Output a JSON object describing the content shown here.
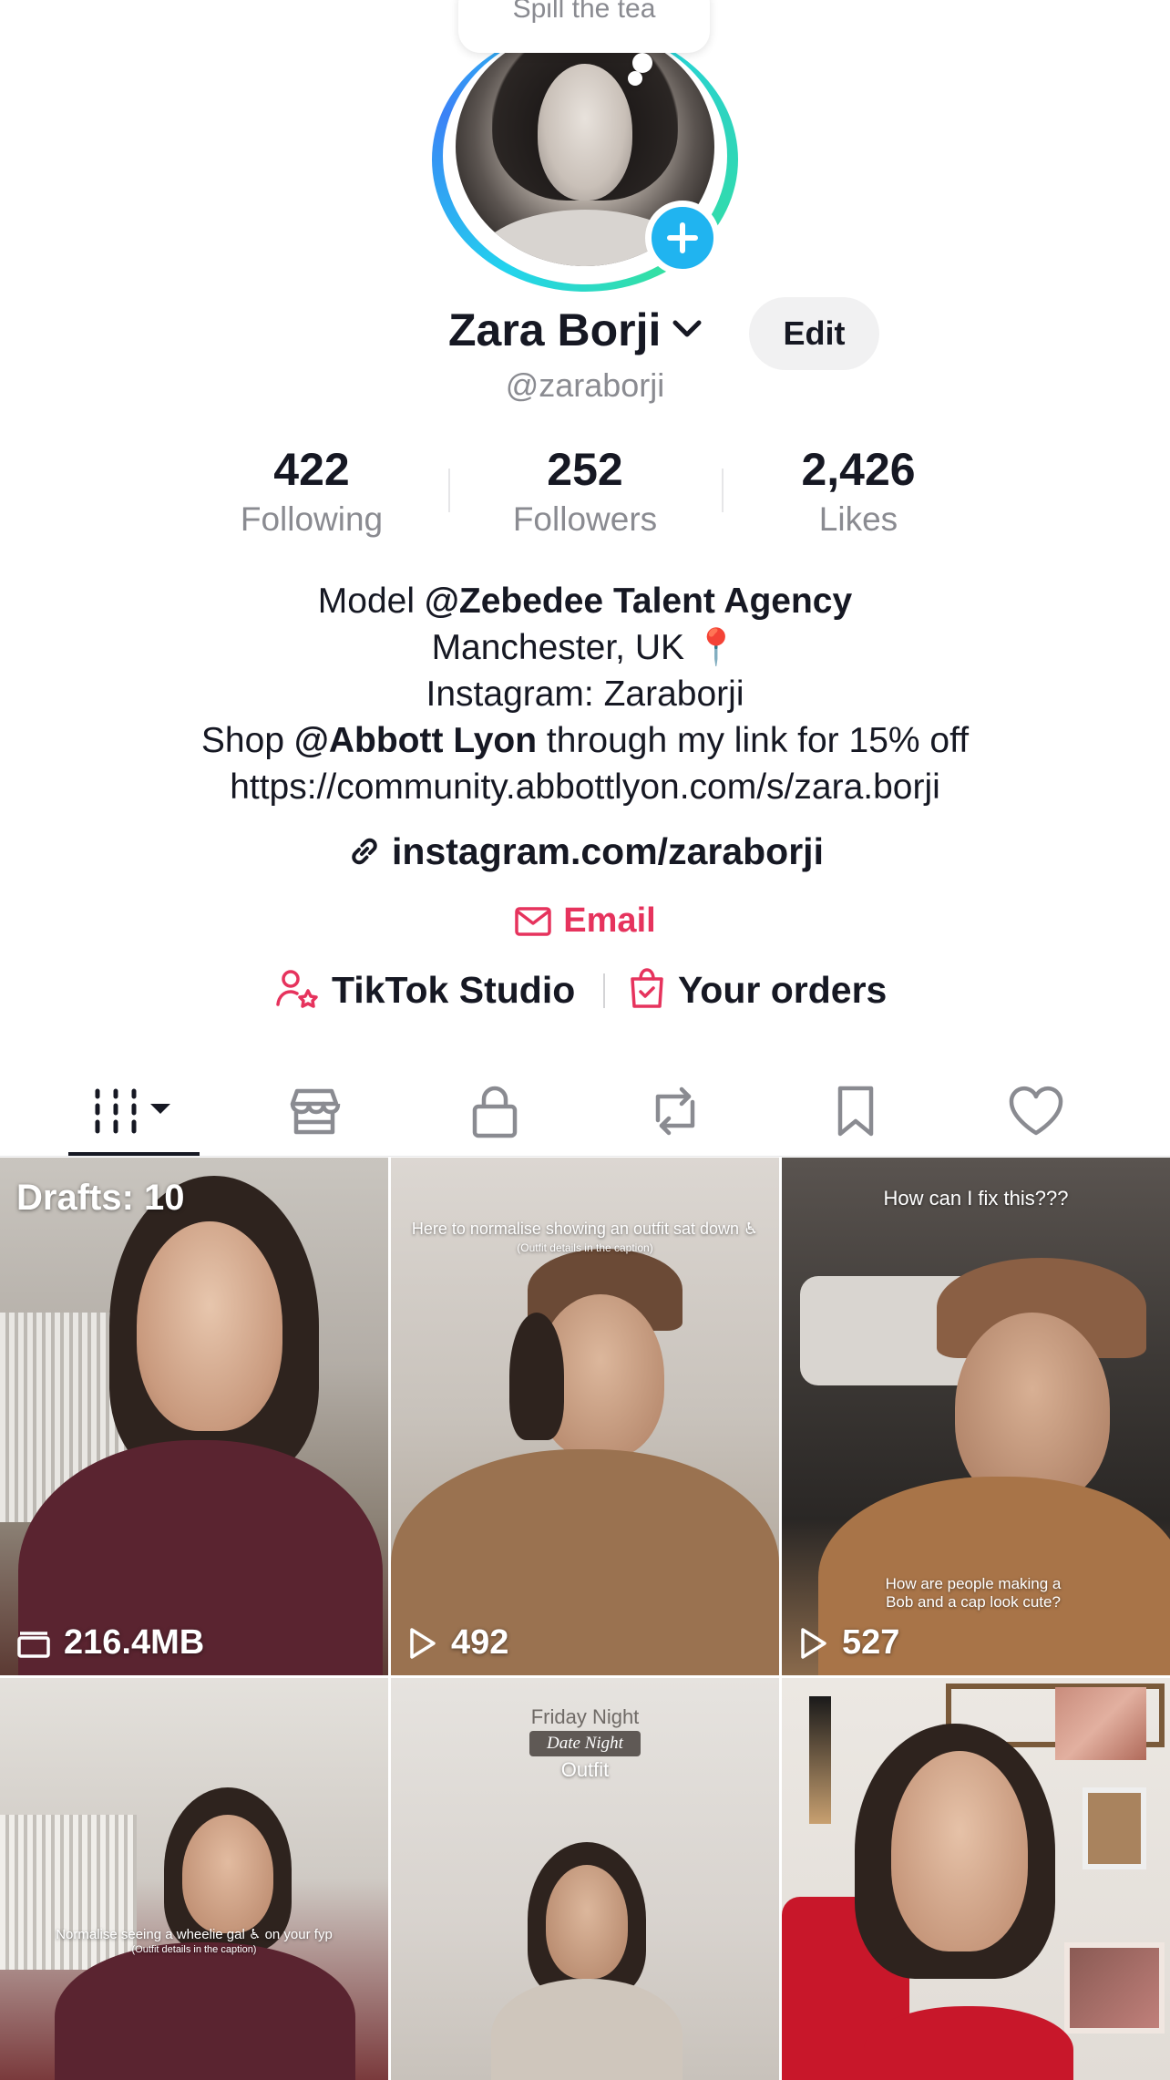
{
  "profile": {
    "thought_bubble": "Spill the tea",
    "name": "Zara Borji",
    "handle": "@zaraborji",
    "edit_label": "Edit"
  },
  "stats": [
    {
      "value": "422",
      "label": "Following"
    },
    {
      "value": "252",
      "label": "Followers"
    },
    {
      "value": "2,426",
      "label": "Likes"
    }
  ],
  "bio": {
    "line1_prefix": "Model ",
    "line1_mention": "@Zebedee Talent Agency",
    "line2": "Manchester, UK",
    "line2_emoji": "📍",
    "line3": "Instagram: Zaraborji",
    "line4_prefix": "Shop ",
    "line4_mention": "@Abbott Lyon",
    "line4_suffix": " through my link for 15% off",
    "line5": "https://community.abbottlyon.com/s/zara.borji"
  },
  "link": "instagram.com/zaraborji",
  "email_label": "Email",
  "tools": {
    "studio_label": "TikTok Studio",
    "orders_label": "Your orders"
  },
  "tabs": [
    {
      "icon": "videos-grid-icon",
      "active": true
    },
    {
      "icon": "shop-icon"
    },
    {
      "icon": "lock-icon"
    },
    {
      "icon": "repost-icon"
    },
    {
      "icon": "bookmark-icon"
    },
    {
      "icon": "heart-icon"
    }
  ],
  "grid": [
    {
      "badge": "Drafts: 10",
      "meta": "216.4MB",
      "meta_icon": "drafts-folder-icon"
    },
    {
      "caption": "Here to normalise showing an outfit sat down ♿",
      "subcaption": "(Outfit details in the caption)",
      "meta": "492",
      "meta_icon": "play-icon"
    },
    {
      "caption": "How can I fix this???",
      "caption2": "How are people making a Bob and a cap look cute?",
      "meta": "527",
      "meta_icon": "play-icon"
    },
    {
      "caption": "Normalise seeing a wheelie gal ♿ on your fyp",
      "subcaption": "(Outfit details in the caption)"
    },
    {
      "caption": "Friday Night",
      "caption_tag": "Date Night",
      "caption_end": "Outfit"
    },
    {}
  ],
  "colors": {
    "accent": "#e6335d",
    "add_badge": "#20b4f0",
    "muted_text": "#8a8b91"
  }
}
